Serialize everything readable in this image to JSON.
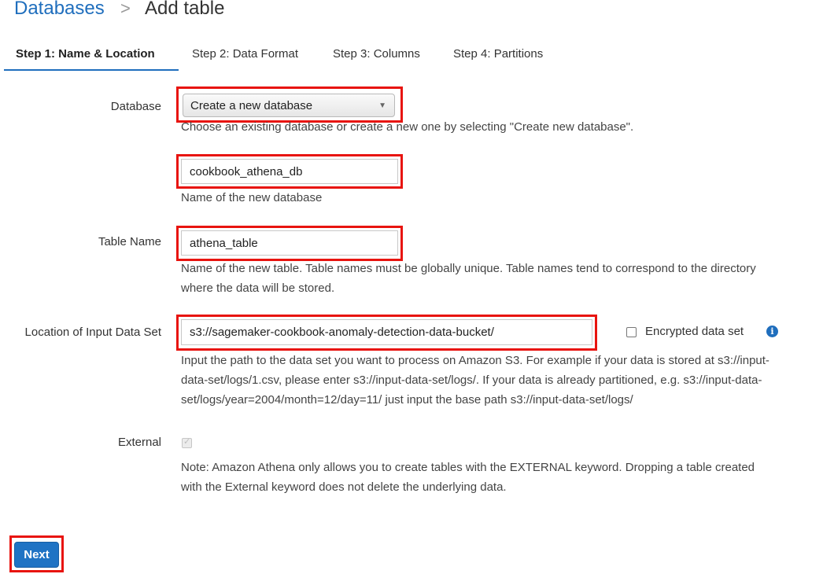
{
  "breadcrumb": {
    "parent": "Databases",
    "separator": ">",
    "current": "Add table"
  },
  "tabs": [
    {
      "label": "Step 1: Name & Location",
      "active": true
    },
    {
      "label": "Step 2: Data Format",
      "active": false
    },
    {
      "label": "Step 3: Columns",
      "active": false
    },
    {
      "label": "Step 4: Partitions",
      "active": false
    }
  ],
  "form": {
    "database": {
      "label": "Database",
      "selected": "Create a new database",
      "help": "Choose an existing database or create a new one by selecting \"Create new database\"."
    },
    "new_database": {
      "value": "cookbook_athena_db",
      "help": "Name of the new database"
    },
    "table_name": {
      "label": "Table Name",
      "value": "athena_table",
      "help_line1": "Name of the new table. Table names must be globally unique. Table names tend to correspond to the directory",
      "help_line2": "where the data will be stored."
    },
    "location": {
      "label": "Location of Input Data Set",
      "value": "s3://sagemaker-cookbook-anomaly-detection-data-bucket/",
      "encrypted_label": "Encrypted data set",
      "encrypted_checked": false,
      "help_line1": "Input the path to the data set you want to process on Amazon S3. For example if your data is stored at s3://input-",
      "help_line2": "data-set/logs/1.csv, please enter s3://input-data-set/logs/. If your data is already partitioned, e.g. s3://input-data-",
      "help_line3": "set/logs/year=2004/month=12/day=11/ just input the base path s3://input-data-set/logs/"
    },
    "external": {
      "label": "External",
      "checked": true,
      "disabled": true,
      "note_line1": "Note: Amazon Athena only allows you to create tables with the EXTERNAL keyword. Dropping a table created",
      "note_line2": "with the External keyword does not delete the underlying data."
    }
  },
  "actions": {
    "next_label": "Next"
  },
  "colors": {
    "accent": "#1f6ebd",
    "highlight": "#e8140f"
  },
  "icons": {
    "dropdown": "caret-down-icon",
    "info": "info-icon"
  }
}
